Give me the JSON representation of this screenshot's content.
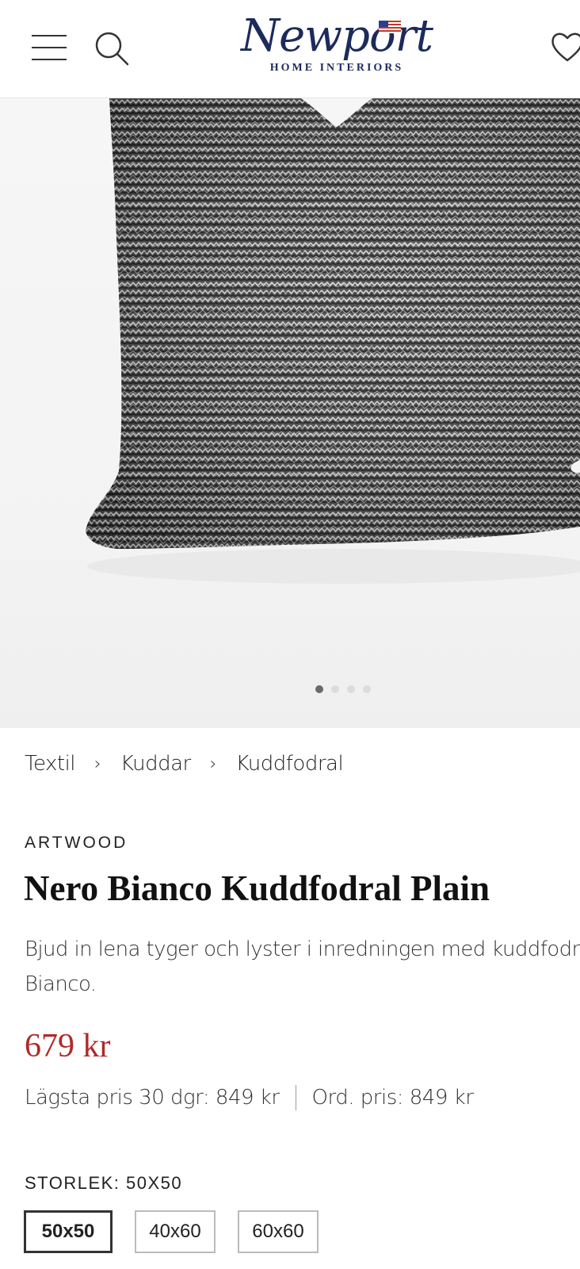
{
  "header": {
    "menu_icon": "hamburger-icon",
    "search_icon": "search-icon",
    "logo_script": "Newport",
    "logo_sub": "HOME INTERIORS",
    "wishlist_icon": "heart-icon"
  },
  "gallery": {
    "image_alt": "Nero Bianco Kuddfodral Plain",
    "slide_count": 4,
    "active_slide": 1
  },
  "breadcrumb": {
    "items": [
      "Textil",
      "Kuddar",
      "Kuddfodral"
    ],
    "separator": "›"
  },
  "product": {
    "brand": "ARTWOOD",
    "title": "Nero Bianco Kuddfodral Plain",
    "description_line1": "Bjud in lena tyger och lyster i inredningen med kuddfodralen N",
    "description_line2": "Bianco.",
    "price": "679 kr",
    "lowest_price": "Lägsta pris 30 dgr: 849 kr",
    "ordinary_price": "Ord. pris: 849 kr",
    "price_color": "#b02a2a"
  },
  "size": {
    "label": "STORLEK: 50X50",
    "options": [
      "50x50",
      "40x60",
      "60x60"
    ],
    "selected": "50x50"
  },
  "colors": {
    "logo_navy": "#1d2b5b"
  }
}
